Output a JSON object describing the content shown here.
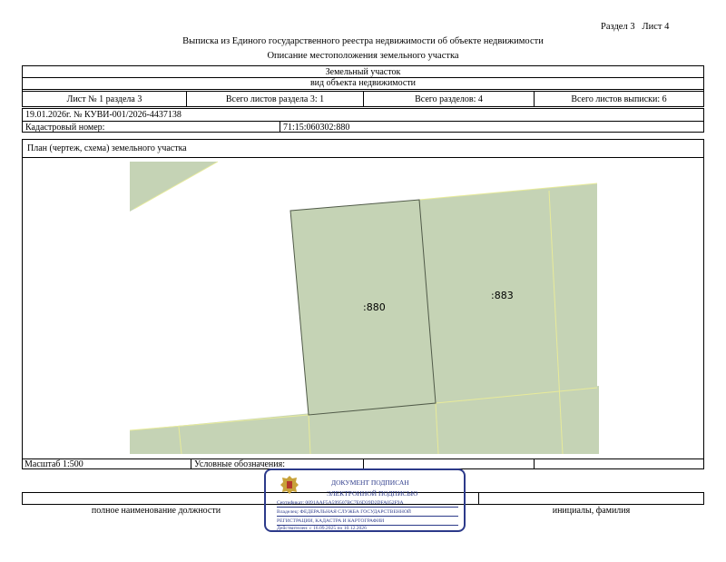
{
  "header": {
    "section": "Раздел 3",
    "sheet": "Лист 4",
    "title": "Выписка из Единого государственного реестра недвижимости об объекте недвижимости",
    "subtitle": "Описание местоположения земельного участка"
  },
  "object": {
    "name": "Земельный участок",
    "kind": "вид объекта недвижимости"
  },
  "sheets": {
    "sheet_of_section": "Лист № 1 раздела 3",
    "total_sheets_section": "Всего листов раздела 3: 1",
    "total_sections": "Всего разделов: 4",
    "total_sheets_extract": "Всего листов выписки: 6"
  },
  "record": {
    "date_number": "19.01.2026г. № КУВИ-001/2026-4437138",
    "cadastral_label": "Кадастровый номер:",
    "cadastral_value": "71:15:060302:880"
  },
  "plan": {
    "title": "План (чертеж, схема) земельного участка",
    "labels": {
      "p880": ":880",
      "p883": ":883"
    },
    "colors": {
      "fill": "#c5d3b5",
      "outline": "#505a48",
      "boundary": "#e8eb9a"
    }
  },
  "footer": {
    "scale": "Масштаб 1:500",
    "legend": "Условные обозначения:",
    "position_caption": "полное наименование должности",
    "name_caption": "инициалы, фамилия"
  },
  "stamp": {
    "line1": "ДОКУМЕНТ ПОДПИСАН",
    "line2": "ЭЛЕКТРОННОЙ ПОДПИСЬЮ",
    "certificate": "Сертификат: 0091AAF5A599507BC7E6D39D2DFA052F9A",
    "owner_line1": "Владелец: ФЕДЕРАЛЬНАЯ СЛУЖБА ГОСУДАРСТВЕННОЙ",
    "owner_line2": "РЕГИСТРАЦИИ, КАДАСТРА И КАРТОГРАФИИ",
    "valid": "Действителен: с 16.09.2025 по 10.12.2026",
    "colors": {
      "ink": "#2c3a8a",
      "emblem": "#c8a23a"
    }
  }
}
